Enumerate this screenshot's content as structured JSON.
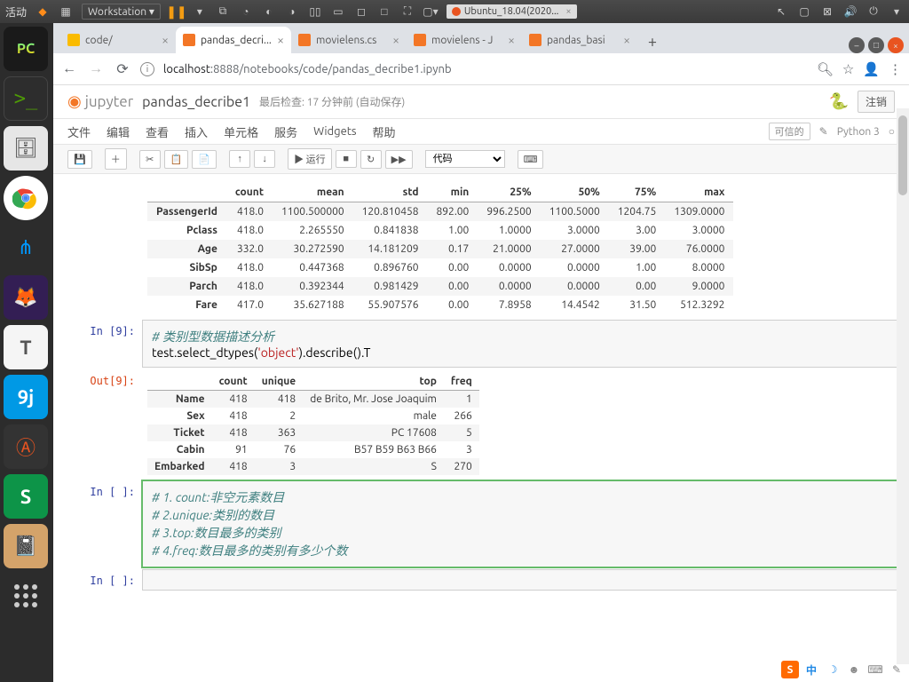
{
  "sysbar": {
    "activities": "活动",
    "workstation": "Workstation",
    "ubuntu_vm": "Ubuntu_18.04(2020..."
  },
  "launcher": {
    "pycharm": "PC",
    "term": ">_",
    "files": "📁",
    "text": "T",
    "gdict": "9j",
    "wps": "S"
  },
  "browser": {
    "tabs": [
      {
        "label": "code/",
        "fav": "folder"
      },
      {
        "label": "pandas_decri...",
        "fav": "nb",
        "active": true
      },
      {
        "label": "movielens.cs",
        "fav": "nb"
      },
      {
        "label": "movielens - J",
        "fav": "nb"
      },
      {
        "label": "pandas_basi",
        "fav": "nb"
      }
    ],
    "url_host": "localhost",
    "url_port": ":8888",
    "url_path": "/notebooks/code/pandas_decribe1.ipynb"
  },
  "jupyter": {
    "logo": "jupyter",
    "title": "pandas_decribe1",
    "last_checkpoint": "最后检查: 17 分钟前 (自动保存)",
    "logout": "注销",
    "menu": [
      "文件",
      "编辑",
      "查看",
      "插入",
      "单元格",
      "服务",
      "Widgets",
      "帮助"
    ],
    "trusted": "可信的",
    "kernel": "Python 3",
    "run_label": "▶ 运行",
    "celltype": "代码",
    "toolbar_cmd": "⌨"
  },
  "describe_numeric": {
    "cols": [
      "count",
      "mean",
      "std",
      "min",
      "25%",
      "50%",
      "75%",
      "max"
    ],
    "rows": [
      {
        "idx": "PassengerId",
        "v": [
          "418.0",
          "1100.500000",
          "120.810458",
          "892.00",
          "996.2500",
          "1100.5000",
          "1204.75",
          "1309.0000"
        ]
      },
      {
        "idx": "Pclass",
        "v": [
          "418.0",
          "2.265550",
          "0.841838",
          "1.00",
          "1.0000",
          "3.0000",
          "3.00",
          "3.0000"
        ]
      },
      {
        "idx": "Age",
        "v": [
          "332.0",
          "30.272590",
          "14.181209",
          "0.17",
          "21.0000",
          "27.0000",
          "39.00",
          "76.0000"
        ]
      },
      {
        "idx": "SibSp",
        "v": [
          "418.0",
          "0.447368",
          "0.896760",
          "0.00",
          "0.0000",
          "0.0000",
          "1.00",
          "8.0000"
        ]
      },
      {
        "idx": "Parch",
        "v": [
          "418.0",
          "0.392344",
          "0.981429",
          "0.00",
          "0.0000",
          "0.0000",
          "0.00",
          "9.0000"
        ]
      },
      {
        "idx": "Fare",
        "v": [
          "417.0",
          "35.627188",
          "55.907576",
          "0.00",
          "7.8958",
          "14.4542",
          "31.50",
          "512.3292"
        ]
      }
    ]
  },
  "cell_in9": {
    "prompt": "In [9]:",
    "comment": "# 类别型数据描述分析",
    "code_pre": "test.select_dtypes(",
    "code_str": "'object'",
    "code_post": ").describe().T"
  },
  "out9_prompt": "Out[9]:",
  "describe_object": {
    "cols": [
      "count",
      "unique",
      "top",
      "freq"
    ],
    "rows": [
      {
        "idx": "Name",
        "v": [
          "418",
          "418",
          "de Brito, Mr. Jose Joaquim",
          "1"
        ]
      },
      {
        "idx": "Sex",
        "v": [
          "418",
          "2",
          "male",
          "266"
        ]
      },
      {
        "idx": "Ticket",
        "v": [
          "418",
          "363",
          "PC 17608",
          "5"
        ]
      },
      {
        "idx": "Cabin",
        "v": [
          "91",
          "76",
          "B57 B59 B63 B66",
          "3"
        ]
      },
      {
        "idx": "Embarked",
        "v": [
          "418",
          "3",
          "S",
          "270"
        ]
      }
    ]
  },
  "cell_notes": {
    "prompt": "In [ ]:",
    "l1": "# 1. count:非空元素数目",
    "l2": "# 2.unique:类别的数目",
    "l3": "# 3.top:数目最多的类别",
    "l4": "# 4.freq:数目最多的类别有多少个数"
  },
  "cell_empty_prompt": "In [ ]:",
  "tray": {
    "sogou": "S",
    "zh": "中"
  }
}
